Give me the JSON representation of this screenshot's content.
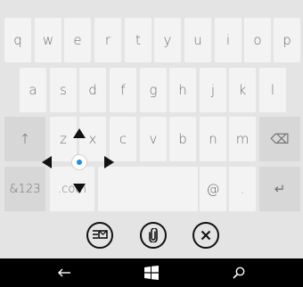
{
  "keyboard": {
    "row1": [
      "q",
      "w",
      "e",
      "r",
      "t",
      "y",
      "u",
      "i",
      "o",
      "p"
    ],
    "row2": [
      "a",
      "s",
      "d",
      "f",
      "g",
      "h",
      "j",
      "k",
      "l"
    ],
    "row3": {
      "shift": "↑",
      "letters": [
        "z",
        "x",
        "c",
        "v",
        "b",
        "n",
        "m"
      ],
      "backspace": "⌫"
    },
    "row4": {
      "numbers": "&123",
      "com": ".com",
      "at": "@",
      "period": ".",
      "enter": "↵"
    }
  },
  "more_label": "...",
  "appbar": {
    "buttons": [
      "email-compose",
      "attach",
      "cancel"
    ]
  },
  "navbar": {
    "back_icon": "back-arrow-icon",
    "start_icon": "windows-start-icon",
    "search_icon": "search-icon"
  },
  "colors": {
    "accent": "#1d8fe0",
    "key_bg": "#f3f3f3",
    "key_dark_bg": "#d7d7d7",
    "keyboard_bg": "#e4e4e4"
  }
}
